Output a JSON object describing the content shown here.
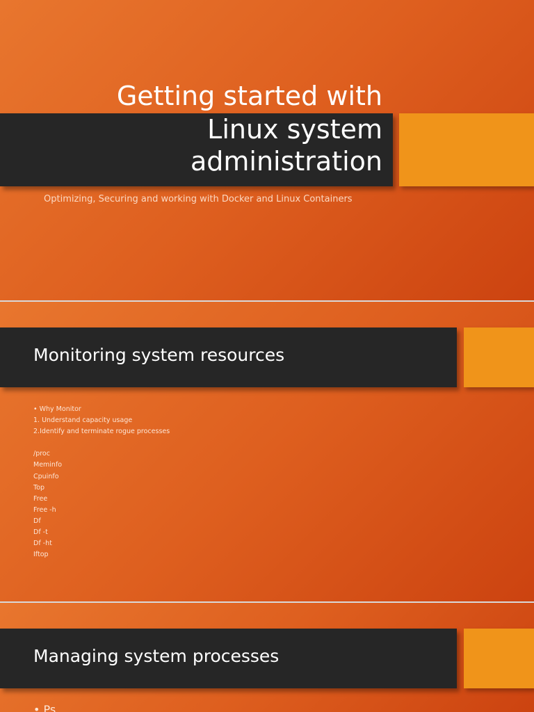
{
  "slide1": {
    "title_line1": "Getting started with",
    "title_line2": "Linux system",
    "title_line3": "administration",
    "subtitle": "Optimizing, Securing and working with Docker and Linux Containers"
  },
  "slide2": {
    "heading": "Monitoring system resources",
    "lines": [
      "• Why Monitor",
      "1. Understand capacity usage",
      "2.Identify and terminate rogue processes",
      "",
      "/proc",
      "Meminfo",
      "Cpuinfo",
      "Top",
      "Free",
      "Free -h",
      "Df",
      "Df -t",
      "Df -ht",
      "Iftop"
    ]
  },
  "slide3": {
    "heading": "Managing system processes",
    "first_bullet": "• Ps"
  }
}
